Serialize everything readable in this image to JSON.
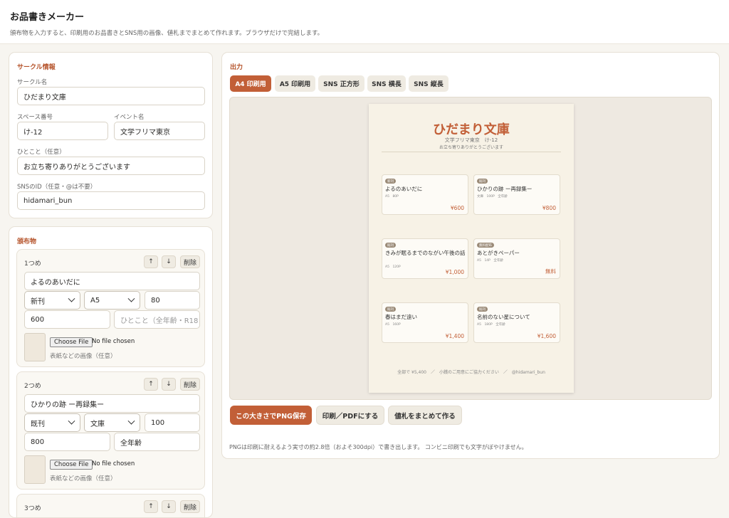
{
  "header": {
    "title": "お品書きメーカー",
    "description": "頒布物を入力すると、印刷用のお品書きとSNS用の画像、値札までまとめて作れます。ブラウザだけで完結します。"
  },
  "circle": {
    "section_title": "サークル情報",
    "name_label": "サークル名",
    "name_value": "ひだまり文庫",
    "space_label": "スペース番号",
    "space_value": "け-12",
    "event_label": "イベント名",
    "event_value": "文学フリマ東京",
    "message_label": "ひとこと（任意）",
    "message_value": "お立ち寄りありがとうございます",
    "sns_label": "SNSのID（任意・@は不要）",
    "sns_value": "hidamari_bun"
  },
  "items_section": {
    "title": "頒布物",
    "up_icon": "↑",
    "down_icon": "↓",
    "delete_label": "削除",
    "choose_file_label": "Choose File",
    "no_file_label": "No file chosen",
    "image_hint": "表紙などの画像（任意）",
    "note_placeholder": "ひとこと（全年齢・R18",
    "items": [
      {
        "label": "1つめ",
        "title": "よるのあいだに",
        "status": "新刊",
        "size": "A5",
        "pages": "80",
        "price": "600",
        "note": ""
      },
      {
        "label": "2つめ",
        "title": "ひかりの跡 ー再録集ー",
        "status": "既刊",
        "size": "文庫",
        "pages": "100",
        "price": "800",
        "note": "全年齢"
      },
      {
        "label": "3つめ"
      }
    ]
  },
  "output": {
    "section_title": "出力",
    "tabs": [
      "A4 印刷用",
      "A5 印刷用",
      "SNS 正方形",
      "SNS 横長",
      "SNS 縦長"
    ],
    "active_tab": 0,
    "buttons": {
      "save_png": "この大きさでPNG保存",
      "print_pdf": "印刷／PDFにする",
      "price_tags": "値札をまとめて作る"
    },
    "note": "PNGは印刷に耐えるよう実寸の約2.8倍（およそ300dpi）で書き出します。 コンビニ印刷でも文字がぼやけません。"
  },
  "preview": {
    "title": "ひだまり文庫",
    "subtitle": "文学フリマ東京　け-12",
    "message": "お立ち寄りありがとうございます",
    "cards": [
      {
        "badge": "新刊",
        "name": "よるのあいだに",
        "meta": "A5　80P",
        "price": "¥600"
      },
      {
        "badge": "既刊",
        "name": "ひかりの跡 ー再録集ー",
        "meta": "文庫　100P　全年齢",
        "price": "¥800"
      },
      {
        "badge": "既刊",
        "name": "きみが眠るまでのながい午後の話",
        "meta": "A5　120P",
        "price": "¥1,000"
      },
      {
        "badge": "無料配布",
        "name": "あとがきペーパー",
        "meta": "A5　14P　全年齢",
        "price": "無料"
      },
      {
        "badge": "既刊",
        "name": "春はまだ遠い",
        "meta": "A5　160P",
        "price": "¥1,400"
      },
      {
        "badge": "既刊",
        "name": "名前のない星について",
        "meta": "A5　180P　全年齢",
        "price": "¥1,600"
      }
    ],
    "footer": "全部で ¥5,400　／　小銭のご用意にご協力ください　／　@hidamari_bun"
  },
  "colors": {
    "accent": "#c25f37",
    "paper": "#f7f2e6",
    "background": "#f7f5f0"
  }
}
